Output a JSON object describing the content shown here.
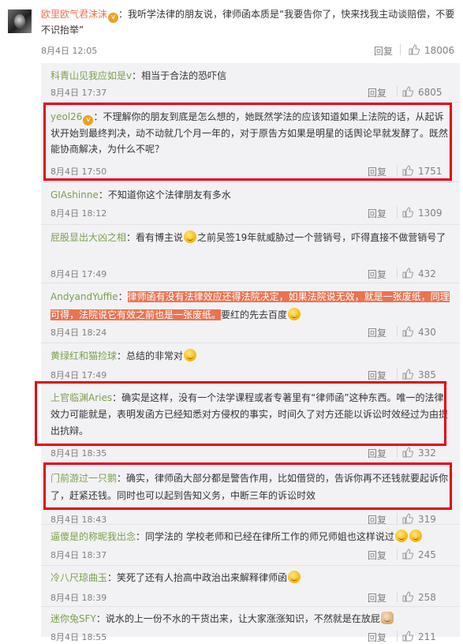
{
  "main_comment": {
    "user": "欧里欧气君沫沫",
    "badge_icon": "vip-badge",
    "text": "：我听学法律的朋友说，律师函本质是“我要告你了，快来找我主动谈赔偿，不要不识抬举”",
    "time": "8月4日 12:05",
    "reply_label": "回复",
    "likes": "18006"
  },
  "replies": [
    {
      "user": "科青山见我应如是v",
      "text": "：相当于合法的恐吓信",
      "time": "8月4日 17:37",
      "reply_label": "回复",
      "likes": "6805"
    },
    {
      "user": "yeol26",
      "badge_icon": "vip-badge",
      "text": "：不理解你的朋友到底是怎么想的，她既然学法的应该知道如果上法院的话，从起诉状开始到最终判决，动不动就几个月一年的，对于原告方如果是明星的话舆论早就发酵了。既然能协商解决，为什么不呢？",
      "time": "8月4日 17:50",
      "reply_label": "回复",
      "likes": "1751"
    },
    {
      "user": "GIAshinne",
      "text": "：不知道你这个法律朋友有多水",
      "time": "8月4日 18:12",
      "reply_label": "回复",
      "likes": "1309"
    },
    {
      "user": "屁股显出大凶之相",
      "text_a": "：看有博主说",
      "text_b": "之前吴签19年就威胁过一个营销号，吓得直接不做营销号了",
      "time": "8月4日 17:49",
      "reply_label": "回复",
      "likes": "432"
    },
    {
      "user": "AndyandYuffie",
      "text_hl": "律师函有没有法律效应还得法院决定，如果法院说无效，就是一张废纸，同理可得，法院说它有效之前也是一张废纸。",
      "text_tail": "要红的先去百度",
      "time": "8月4日 18:24",
      "reply_label": "回复",
      "likes": "430"
    },
    {
      "user": "黄绿红和猫捡球",
      "text": "：总结的非常对",
      "time": "8月4日 17:49",
      "reply_label": "回复",
      "likes": "385"
    },
    {
      "user": "上官临渊Aries",
      "text": "：确实是这样，没有一个法学课程或者专著里有“律师函”这种东西。唯一的法律效力可能就是，表明发函方已经知悉对方侵权的事实，时间久了对方还能以诉讼时效经过为由提出抗辩。",
      "time": "8月4日 18:35",
      "reply_label": "回复",
      "likes": "332"
    },
    {
      "user": "门前游过一只鹅",
      "text": "：确实，律师函大部分都是警告作用，比如借贷的，告诉你再不还钱就要起诉你了，赶紧还钱。同时也可以起到告知义务，中断三年的诉讼时效",
      "time": "8月4日 18:43",
      "reply_label": "回复",
      "likes": "319"
    },
    {
      "user": "逼傻是的称昵我出念",
      "text": "：同学法的 学校老师和已经在律所工作的师兄师姐也这样说过",
      "time": "8月4日 18:37",
      "reply_label": "回复",
      "likes": "245"
    },
    {
      "user": "冷八尺琼曲玉",
      "text": "：笑死了还有人抬高中政治出来解释律师函",
      "time": "8月4日 18:39",
      "reply_label": "回复",
      "likes": "258"
    },
    {
      "user": "迷你兔SFY",
      "text": "：说水的上一份不水的干货出来，让大家涨涨知识，不然就是在放屁",
      "time": "8月4日 18:55",
      "reply_label": "回复",
      "likes": "211"
    }
  ],
  "colors": {
    "username": "#eb7350",
    "panel_bg": "#f2f2f5",
    "highlight_box": "#e60012",
    "meta": "#808080"
  }
}
